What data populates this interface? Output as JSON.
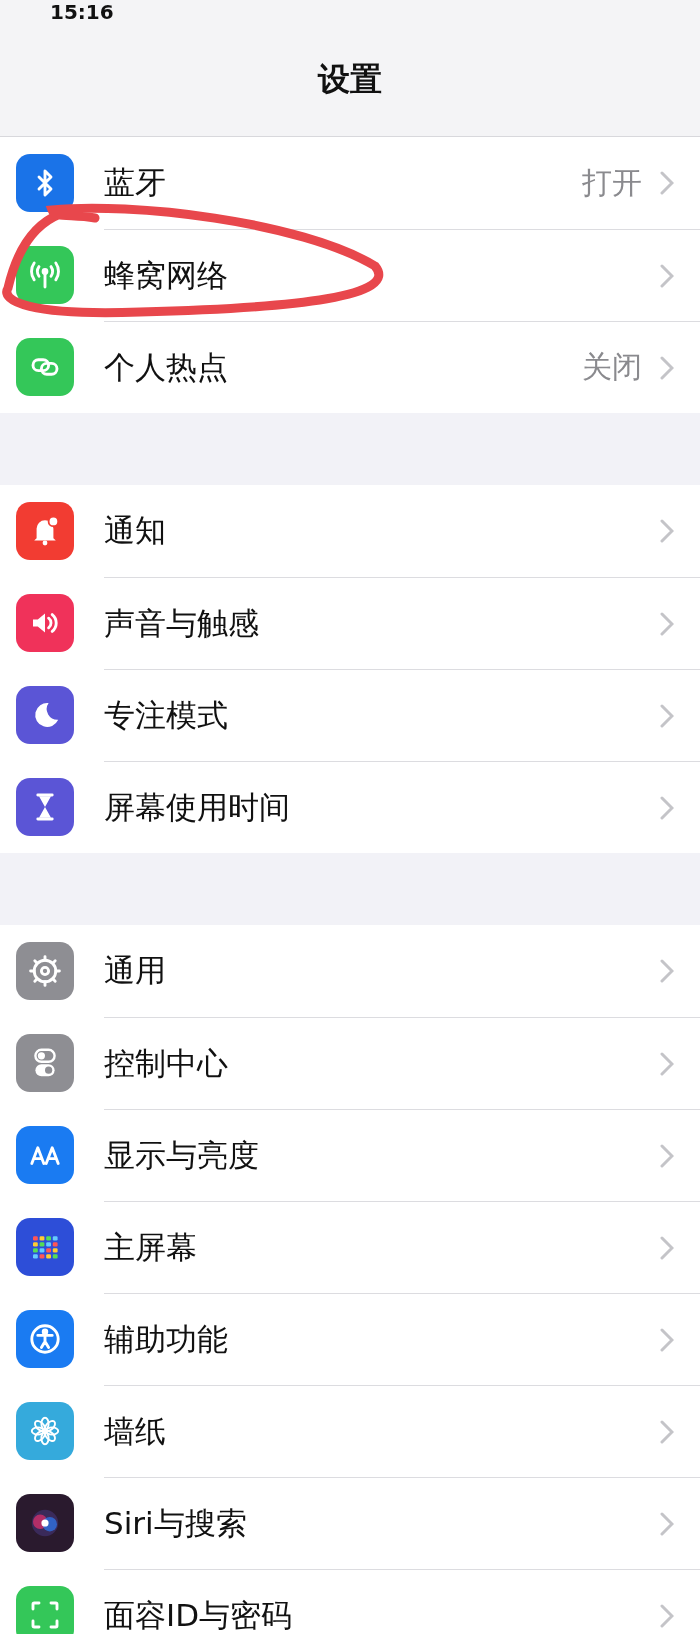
{
  "status_bar": {
    "time": "15:16"
  },
  "nav": {
    "title": "设置"
  },
  "groups": [
    {
      "items": [
        {
          "label": "蓝牙",
          "value": "打开",
          "kind": "bluetooth",
          "color": "#1a73e8"
        },
        {
          "label": "蜂窝网络",
          "kind": "antenna",
          "color": "#34c759"
        },
        {
          "label": "个人热点",
          "value": "关闭",
          "kind": "link",
          "color": "#34c759"
        }
      ]
    },
    {
      "items": [
        {
          "label": "通知",
          "kind": "bell",
          "color": "#f23c32"
        },
        {
          "label": "声音与触感",
          "kind": "speaker",
          "color": "#f0325a"
        },
        {
          "label": "专注模式",
          "kind": "moon",
          "color": "#5b55d6"
        },
        {
          "label": "屏幕使用时间",
          "kind": "hourglass",
          "color": "#5b55d6"
        }
      ]
    },
    {
      "items": [
        {
          "label": "通用",
          "kind": "gear",
          "color": "#8e8e93"
        },
        {
          "label": "控制中心",
          "kind": "toggles",
          "color": "#8e8e93"
        },
        {
          "label": "显示与亮度",
          "kind": "text-size",
          "color": "#1a7bf2"
        },
        {
          "label": "主屏幕",
          "kind": "grid",
          "color": "#2d4ed8"
        },
        {
          "label": "辅助功能",
          "kind": "accessibility",
          "color": "#1a7bf2"
        },
        {
          "label": "墙纸",
          "kind": "flower",
          "color": "#35aadc"
        },
        {
          "label": "Siri与搜索",
          "kind": "siri",
          "color": "#2a1a2e"
        },
        {
          "label": "面容ID与密码",
          "kind": "face-scan",
          "color": "#34c759"
        }
      ]
    }
  ]
}
